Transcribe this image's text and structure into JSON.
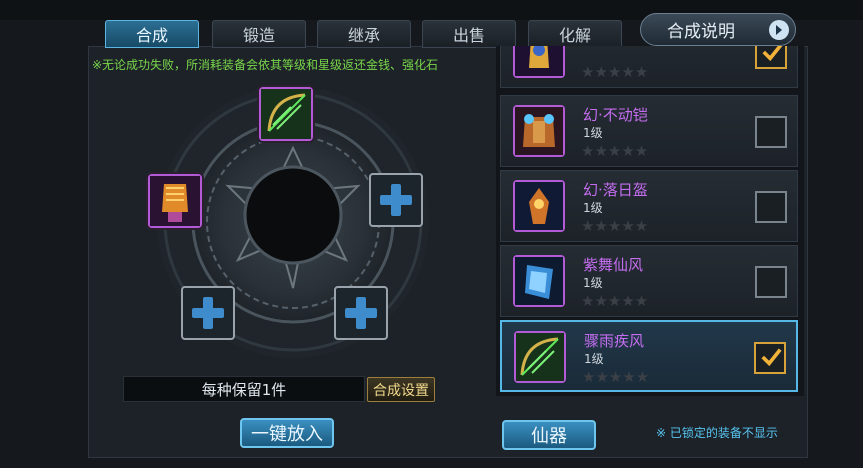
{
  "tabs": [
    {
      "label": "合成",
      "active": true
    },
    {
      "label": "锻造",
      "active": false
    },
    {
      "label": "继承",
      "active": false
    },
    {
      "label": "出售",
      "active": false
    },
    {
      "label": "化解",
      "active": false
    }
  ],
  "help_button": "合成说明",
  "notice": "※无论成功失败，所消耗装备会依其等级和星级返还金钱、强化石",
  "keep_text": "每种保留1件",
  "settings_button": "合成设置",
  "one_click_button": "一键放入",
  "category_button": "仙器",
  "footnote": "※ 已锁定的装备不显示",
  "items": [
    {
      "name": "",
      "level": "",
      "stars": "★★★★★",
      "checked": true
    },
    {
      "name": "幻·不动铠",
      "level": "1级",
      "stars": "★★★★★",
      "checked": false
    },
    {
      "name": "幻·落日盔",
      "level": "1级",
      "stars": "★★★★★",
      "checked": false
    },
    {
      "name": "紫舞仙风",
      "level": "1级",
      "stars": "★★★★★",
      "checked": false
    },
    {
      "name": "骤雨疾风",
      "level": "1级",
      "stars": "★★★★★",
      "checked": true
    }
  ],
  "colors": {
    "accent": "#56b8e6",
    "purple_name": "#c46df0",
    "notice_green": "#79d64a"
  }
}
